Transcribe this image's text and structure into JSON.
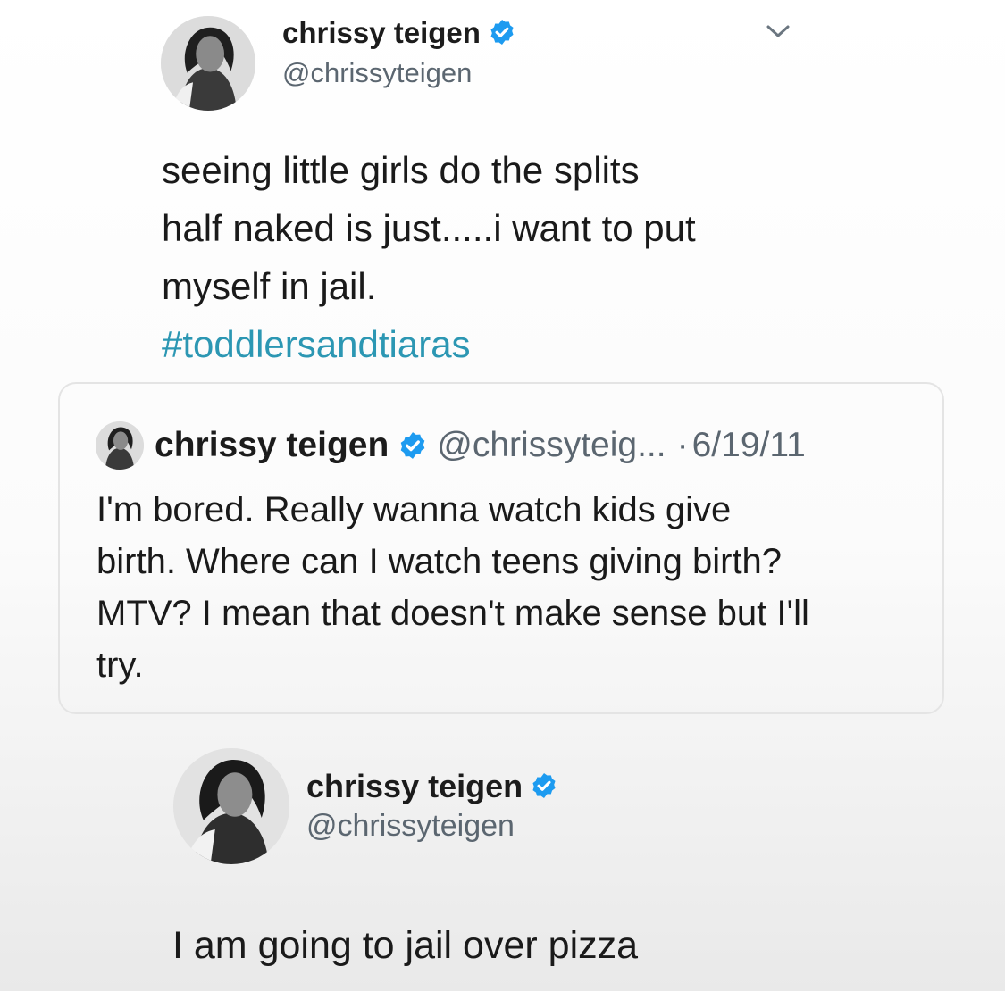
{
  "top_tweet": {
    "name": "chrissy teigen",
    "handle": "@chrissyteigen",
    "body": "seeing little girls do the splits\nhalf naked is just.....i want to put\nmyself in jail.",
    "hashtag": "#toddlersandtiaras",
    "menu_icon": "chevron-down-icon",
    "verified_icon": "verified-badge-icon"
  },
  "quoted_tweet": {
    "name": "chrissy teigen",
    "handle": "@chrissyteig...",
    "separator": "·",
    "date": "6/19/11",
    "body": "I'm bored. Really wanna watch kids give\nbirth. Where can I watch teens giving birth?\nMTV? I mean that doesn't make sense but I'll\ntry."
  },
  "bottom_tweet": {
    "name": "chrissy teigen",
    "handle": "@chrissyteigen",
    "body": "I am going to jail over pizza"
  },
  "colors": {
    "verified": "#1d9bf0",
    "hashtag": "#2c97b3",
    "secondary_text": "#5b6670"
  }
}
